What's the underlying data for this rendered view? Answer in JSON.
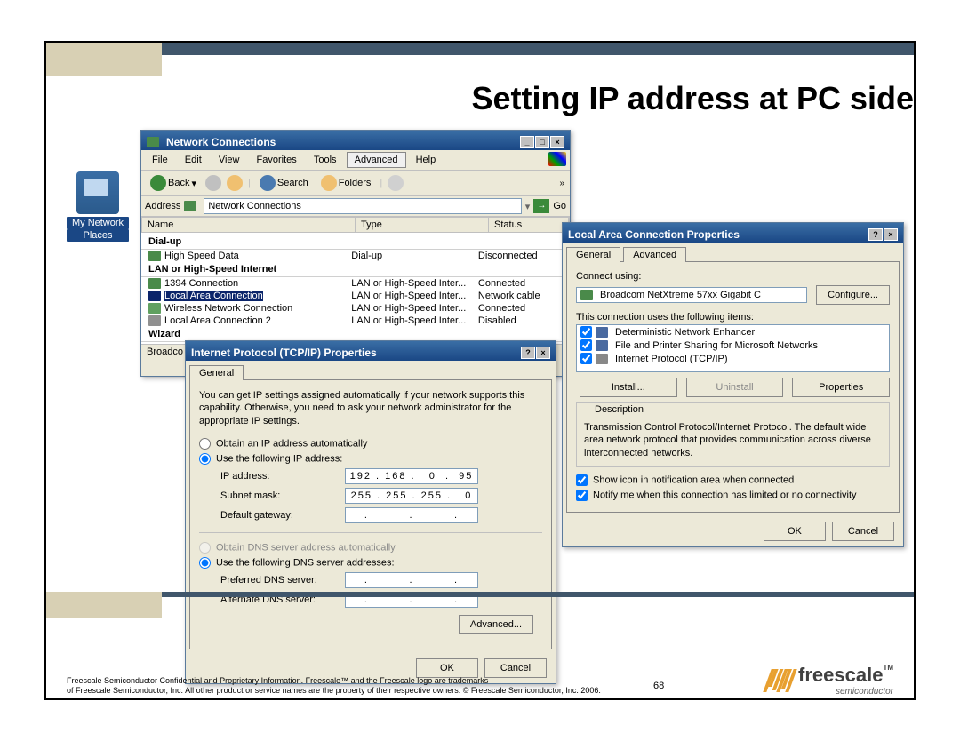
{
  "slide": {
    "title": "Setting IP address at PC side",
    "page_number": "68",
    "legal_line1": "Freescale Semiconductor Confidential and Proprietary Information. Freescale™ and the Freescale logo are trademarks",
    "legal_line2": "of Freescale Semiconductor, Inc. All other product or service names are the property of their respective owners. © Freescale Semiconductor, Inc. 2006.",
    "brand": "freescale",
    "brand_tm": "TM",
    "brand_sub": "semiconductor"
  },
  "desktop_icon": {
    "line1": "My Network",
    "line2": "Places"
  },
  "netconn": {
    "title": "Network Connections",
    "menu": [
      "File",
      "Edit",
      "View",
      "Favorites",
      "Tools",
      "Advanced",
      "Help"
    ],
    "back": "Back",
    "search": "Search",
    "folders": "Folders",
    "addr_label": "Address",
    "addr_value": "Network Connections",
    "go": "Go",
    "cols": {
      "name": "Name",
      "type": "Type",
      "status": "Status"
    },
    "groups": {
      "dialup": "Dial-up",
      "lan": "LAN or High-Speed Internet",
      "wizard": "Wizard"
    },
    "rows": {
      "hsd": {
        "name": "High Speed Data",
        "type": "Dial-up",
        "status": "Disconnected"
      },
      "r1394": {
        "name": "1394 Connection",
        "type": "LAN or High-Speed Inter...",
        "status": "Connected"
      },
      "lac": {
        "name": "Local Area Connection",
        "type": "LAN or High-Speed Inter...",
        "status": "Network cable"
      },
      "wlan": {
        "name": "Wireless Network Connection",
        "type": "LAN or High-Speed Inter...",
        "status": "Connected"
      },
      "lac2": {
        "name": "Local Area Connection 2",
        "type": "LAN or High-Speed Inter...",
        "status": "Disabled"
      }
    },
    "status_prefix": "Broadco"
  },
  "tcpip": {
    "title": "Internet Protocol (TCP/IP) Properties",
    "tab": "General",
    "help": "You can get IP settings assigned automatically if your network supports this capability. Otherwise, you need to ask your network administrator for the appropriate IP settings.",
    "opt_auto_ip": "Obtain an IP address automatically",
    "opt_use_ip": "Use the following IP address:",
    "ip_label": "IP address:",
    "ip_value": "192 . 168 .   0  .  95",
    "mask_label": "Subnet mask:",
    "mask_value": "255 . 255 . 255 .   0",
    "gw_label": "Default gateway:",
    "gw_value": ".         .         .",
    "opt_auto_dns": "Obtain DNS server address automatically",
    "opt_use_dns": "Use the following DNS server addresses:",
    "pdns_label": "Preferred DNS server:",
    "adns_label": "Alternate DNS server:",
    "advanced": "Advanced...",
    "ok": "OK",
    "cancel": "Cancel"
  },
  "lacprop": {
    "title": "Local Area Connection Properties",
    "tab_general": "General",
    "tab_advanced": "Advanced",
    "connect_using": "Connect using:",
    "adapter": "Broadcom NetXtreme 57xx Gigabit C",
    "configure": "Configure...",
    "items_label": "This connection uses the following items:",
    "item1": "Deterministic Network Enhancer",
    "item2": "File and Printer Sharing for Microsoft Networks",
    "item3": "Internet Protocol (TCP/IP)",
    "install": "Install...",
    "uninstall": "Uninstall",
    "properties": "Properties",
    "desc_label": "Description",
    "desc_text": "Transmission Control Protocol/Internet Protocol. The default wide area network protocol that provides communication across diverse interconnected networks.",
    "show_icon": "Show icon in notification area when connected",
    "notify_me": "Notify me when this connection has limited or no connectivity",
    "ok": "OK",
    "cancel": "Cancel"
  }
}
